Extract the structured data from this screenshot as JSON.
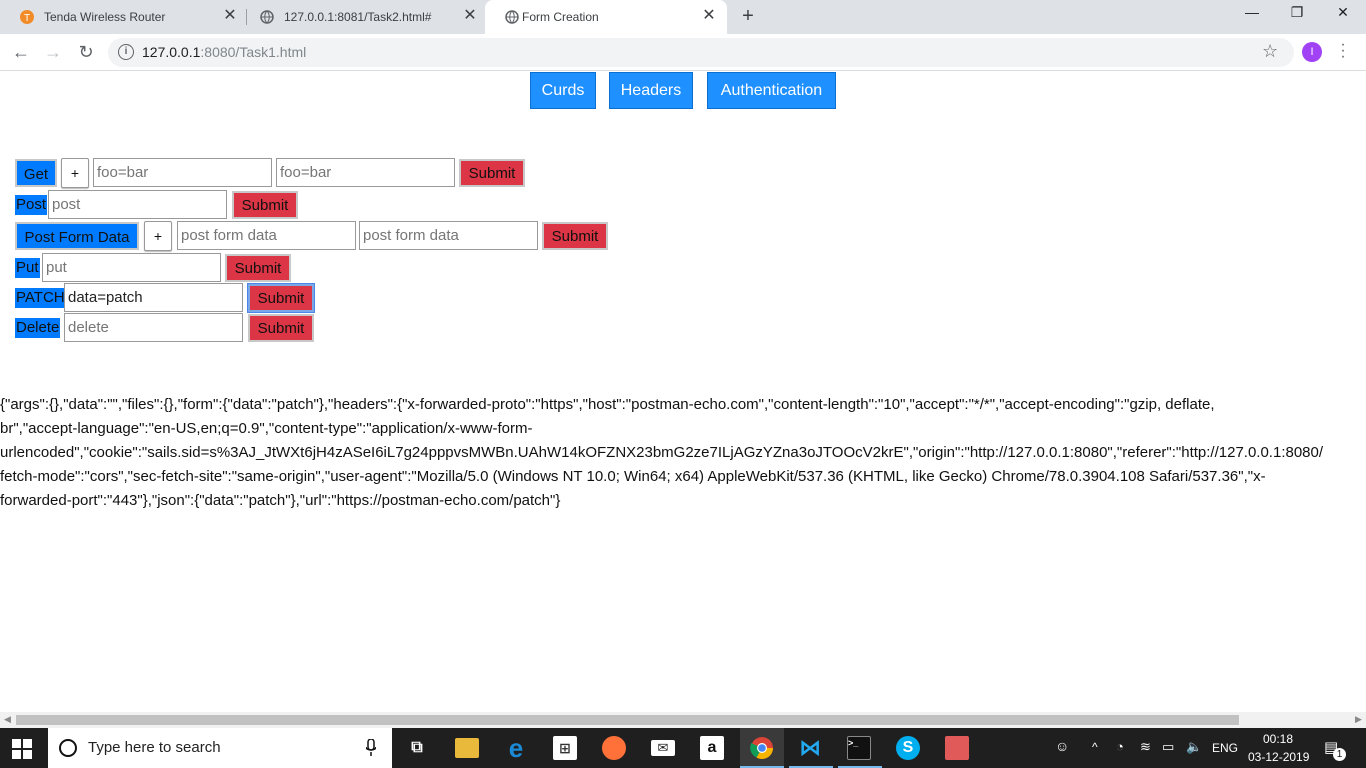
{
  "browser": {
    "tabs": [
      {
        "title": "Tenda Wireless Router",
        "close": "✕"
      },
      {
        "title": "127.0.0.1:8081/Task2.html#",
        "close": "✕"
      },
      {
        "title": "Form Creation",
        "close": "✕"
      }
    ],
    "new_tab": "+",
    "url_host": "127.0.0.1",
    "url_rest": ":8080/Task1.html",
    "avatar_letter": "I",
    "controls": {
      "minimize": "—",
      "maximize": "❐",
      "close": "✕"
    }
  },
  "nav": {
    "curds": "Curds",
    "headers": "Headers",
    "authentication": "Authentication"
  },
  "forms": {
    "get": {
      "label": "Get",
      "plus": "+",
      "key_placeholder": "foo=bar",
      "value_placeholder": "foo=bar",
      "submit": "Submit"
    },
    "post": {
      "label": "Post",
      "placeholder": "post",
      "submit": "Submit"
    },
    "post_form": {
      "label": "Post Form Data",
      "plus": "+",
      "key_placeholder": "post form data",
      "value_placeholder": "post form data",
      "submit": "Submit"
    },
    "put": {
      "label": "Put",
      "placeholder": "put",
      "submit": "Submit"
    },
    "patch": {
      "label": "PATCH",
      "value": "data=patch",
      "submit": "Submit"
    },
    "delete": {
      "label": "Delete",
      "placeholder": "delete",
      "submit": "Submit"
    }
  },
  "response": {
    "line1": "{\"args\":{},\"data\":\"\",\"files\":{},\"form\":{\"data\":\"patch\"},\"headers\":{\"x-forwarded-proto\":\"https\",\"host\":\"postman-echo.com\",\"content-length\":\"10\",\"accept\":\"*/*\",\"accept-encoding\":\"gzip, deflate,",
    "line2": "br\",\"accept-language\":\"en-US,en;q=0.9\",\"content-type\":\"application/x-www-form-",
    "line3": "urlencoded\",\"cookie\":\"sails.sid=s%3AJ_JtWXt6jH4zASeI6iL7g24pppvsMWBn.UAhW14kOFZNX23bmG2ze7ILjAGzYZna3oJTOOcV2krE\",\"origin\":\"http://127.0.0.1:8080\",\"referer\":\"http://127.0.0.1:8080/",
    "line4": "fetch-mode\":\"cors\",\"sec-fetch-site\":\"same-origin\",\"user-agent\":\"Mozilla/5.0 (Windows NT 10.0; Win64; x64) AppleWebKit/537.36 (KHTML, like Gecko) Chrome/78.0.3904.108 Safari/537.36\",\"x-",
    "line5": "forwarded-port\":\"443\"},\"json\":{\"data\":\"patch\"},\"url\":\"https://postman-echo.com/patch\"}"
  },
  "taskbar": {
    "search_text": "Type here to search",
    "language": "ENG",
    "time": "00:18",
    "date": "03-12-2019",
    "notification_count": "1"
  }
}
